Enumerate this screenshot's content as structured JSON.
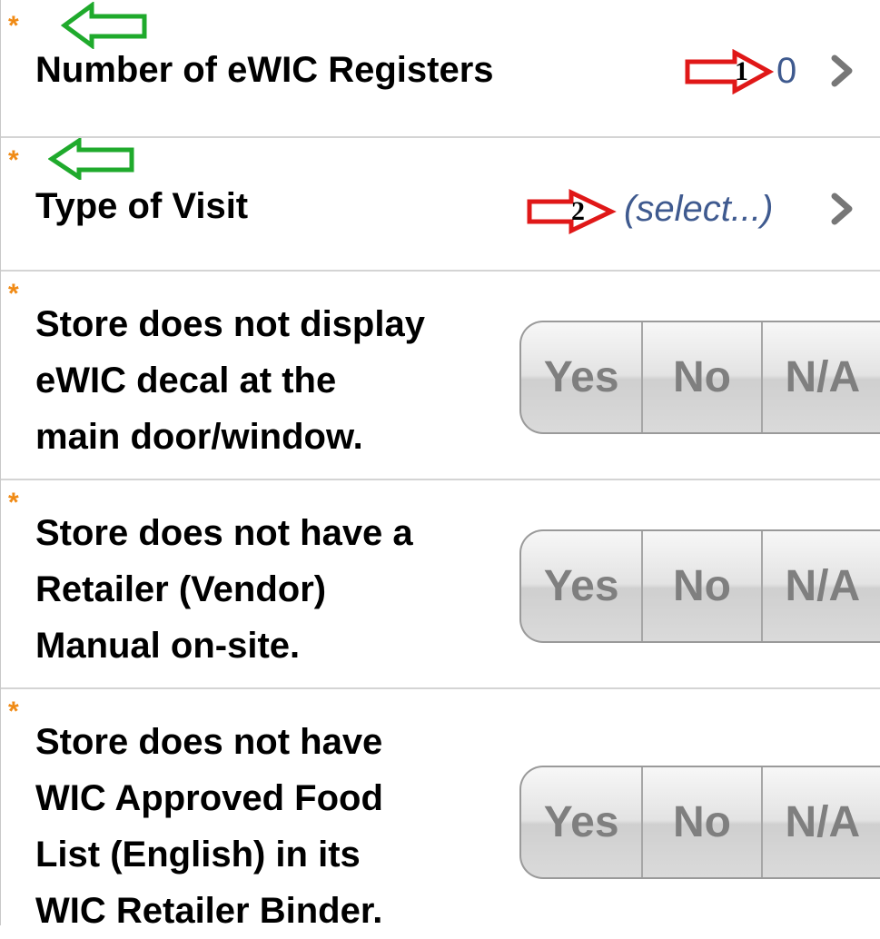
{
  "required_marker": "*",
  "rows": [
    {
      "label": "Number of eWIC Registers",
      "value": "0",
      "annotation_number": "1"
    },
    {
      "label": "Type of Visit",
      "value": "(select...)",
      "annotation_number": "2"
    },
    {
      "label_lines": [
        "Store does not display",
        "eWIC decal at the",
        "main door/window."
      ],
      "options": [
        "Yes",
        "No",
        "N/A"
      ]
    },
    {
      "label_lines": [
        "Store does not have a",
        "Retailer (Vendor)",
        "Manual on-site."
      ],
      "options": [
        "Yes",
        "No",
        "N/A"
      ]
    },
    {
      "label_lines": [
        "Store does not have",
        "WIC Approved Food",
        "List (English) in its",
        "WIC Retailer Binder."
      ],
      "options": [
        "Yes",
        "No",
        "N/A"
      ]
    }
  ],
  "colors": {
    "required_star": "#f08a14",
    "value_text": "#3f5a8f",
    "annotation_green": "#1faa2c",
    "annotation_red": "#e01818"
  },
  "icons": [
    "chevron-right-icon",
    "green-arrow-annotation",
    "red-arrow-annotation"
  ]
}
